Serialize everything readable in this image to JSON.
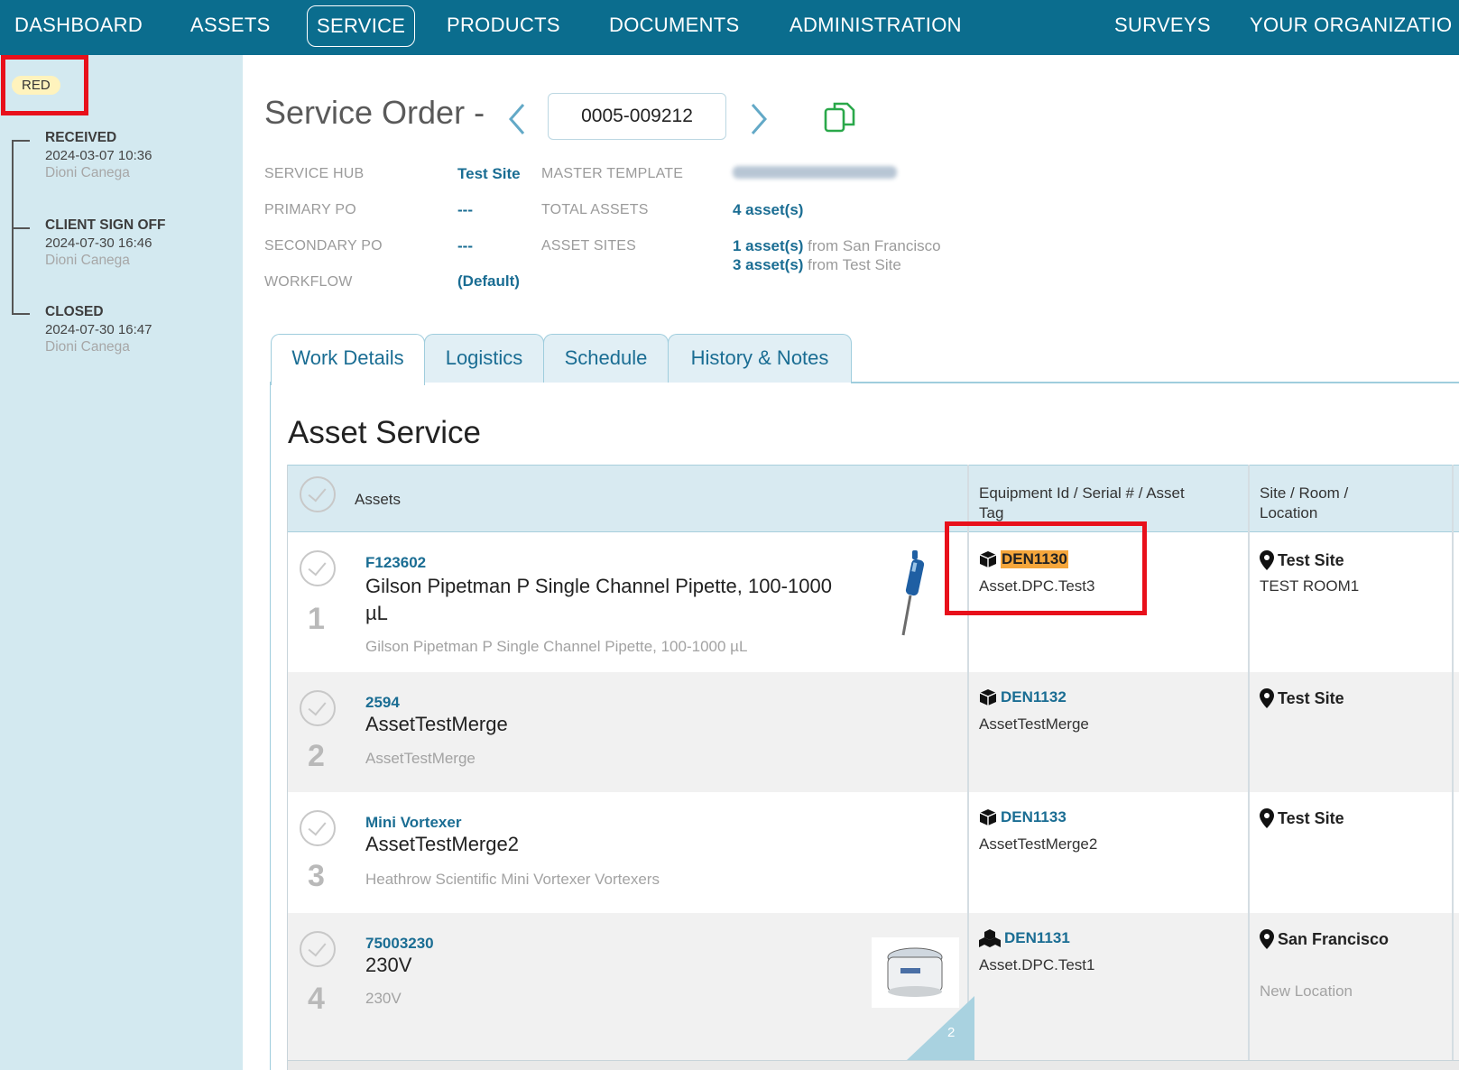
{
  "nav": {
    "items": [
      "DASHBOARD",
      "ASSETS",
      "SERVICE",
      "PRODUCTS",
      "DOCUMENTS",
      "ADMINISTRATION",
      "SURVEYS",
      "YOUR ORGANIZATIO"
    ],
    "active": "SERVICE"
  },
  "sidebar": {
    "status_badge": "RED",
    "timeline": [
      {
        "status": "RECEIVED",
        "date": "2024-03-07 10:36",
        "user": "Dioni Canega"
      },
      {
        "status": "CLIENT SIGN OFF",
        "date": "2024-07-30 16:46",
        "user": "Dioni Canega"
      },
      {
        "status": "CLOSED",
        "date": "2024-07-30 16:47",
        "user": "Dioni Canega"
      }
    ]
  },
  "header": {
    "title": "Service Order -",
    "order_number": "0005-009212",
    "prev_icon": "chevron-left-icon",
    "next_icon": "chevron-right-icon",
    "copy_icon": "copy-icon"
  },
  "meta": {
    "service_hub_label": "SERVICE HUB",
    "service_hub_value": "Test Site",
    "primary_po_label": "PRIMARY PO",
    "primary_po_value": "---",
    "secondary_po_label": "SECONDARY PO",
    "secondary_po_value": "---",
    "workflow_label": "WORKFLOW",
    "workflow_value": "(Default)",
    "master_template_label": "MASTER TEMPLATE",
    "total_assets_label": "TOTAL ASSETS",
    "total_assets_value": "4 asset(s)",
    "asset_sites_label": "ASSET SITES",
    "asset_sites": [
      {
        "count": "1 asset(s)",
        "text": "from San Francisco"
      },
      {
        "count": "3 asset(s)",
        "text": "from Test Site"
      }
    ]
  },
  "tabs": [
    "Work Details",
    "Logistics",
    "Schedule",
    "History & Notes"
  ],
  "section_title": "Asset Service",
  "table": {
    "headers": {
      "assets": "Assets",
      "equipment_line1": "Equipment Id / Serial # / Asset",
      "equipment_line2": "Tag",
      "site_line1": "Site / Room /",
      "site_line2": "Location"
    },
    "rows": [
      {
        "num": "1",
        "id": "F123602",
        "name": "Gilson Pipetman P Single Channel Pipette, 100-1000 µL",
        "desc": "Gilson Pipetman P Single Channel Pipette, 100-1000 µL",
        "equip": "DEN1130",
        "equip_sub": "Asset.DPC.Test3",
        "site": "Test Site",
        "room": "TEST ROOM1"
      },
      {
        "num": "2",
        "id": "2594",
        "name": "AssetTestMerge",
        "desc": "AssetTestMerge",
        "equip": "DEN1132",
        "equip_sub": "AssetTestMerge",
        "site": "Test Site",
        "room": ""
      },
      {
        "num": "3",
        "id": "Mini Vortexer",
        "name": "AssetTestMerge2",
        "desc": "Heathrow Scientific Mini Vortexer Vortexers",
        "equip": "DEN1133",
        "equip_sub": "AssetTestMerge2",
        "site": "Test Site",
        "room": ""
      },
      {
        "num": "4",
        "id": "75003230",
        "name": "230V",
        "desc": "230V",
        "equip": "DEN1131",
        "equip_sub": "Asset.DPC.Test1",
        "site": "San Francisco",
        "room": "New Location"
      }
    ],
    "corner_count": "2"
  },
  "colors": {
    "nav_bg": "#0b6d8e",
    "sidebar_bg": "#d3e9f0",
    "link": "#1a6d93",
    "highlight_box": "#e8101b",
    "tag_highlight": "#f5a63b",
    "copy_green": "#2aa84a"
  }
}
